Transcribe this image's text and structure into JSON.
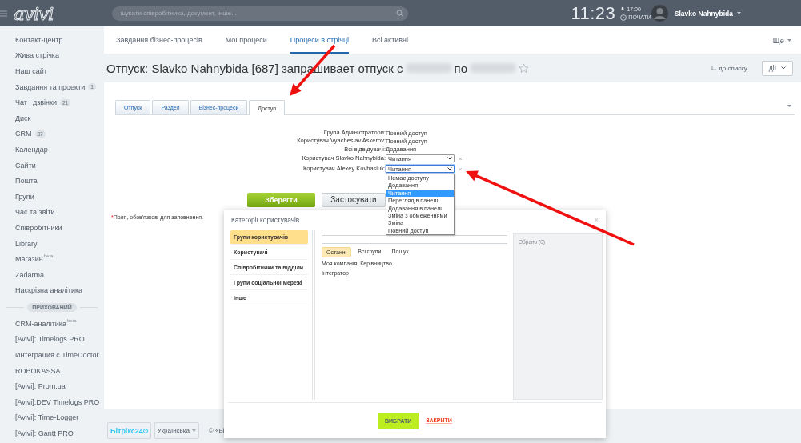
{
  "header": {
    "logo": "avivi",
    "search": {
      "placeholder": "шукати співробітника, документ, інше..."
    },
    "clock": "11:23",
    "alarm": "17:00",
    "start": "ПОЧАТИ",
    "user": "Slavko Nahnybida"
  },
  "sidebar": {
    "items": [
      {
        "label": "Контакт-центр"
      },
      {
        "label": "Жива стрічка"
      },
      {
        "label": "Наш сайт"
      },
      {
        "label": "Завдання та проекти",
        "counter": "1"
      },
      {
        "label": "Чат і дзвінки",
        "counter": "21"
      },
      {
        "label": "Диск"
      },
      {
        "label": "CRM",
        "counter": "37"
      },
      {
        "label": "Календар"
      },
      {
        "label": "Сайти"
      },
      {
        "label": "Пошта"
      },
      {
        "label": "Групи"
      },
      {
        "label": "Час та звіти"
      },
      {
        "label": "Співробітники"
      },
      {
        "label": "Library"
      },
      {
        "label": "Магазин",
        "sup": "beta"
      },
      {
        "label": "Zadarma"
      },
      {
        "label": "Наскрізна аналітика"
      }
    ],
    "hidden_label": "ПРИХОВАНИЙ",
    "hidden_items": [
      {
        "label": "CRM-аналітика",
        "sup": "beta"
      },
      {
        "label": "[Avivi]: Timelogs PRO"
      },
      {
        "label": "Интеграция с TimeDoctor"
      },
      {
        "label": "ROBOKASSA"
      },
      {
        "label": "[Avivi]: Prom.ua"
      },
      {
        "label": "[Avivi]:DEV Timelogs PRO"
      },
      {
        "label": "[Avivi]: Time-Logger"
      },
      {
        "label": "[Avivi]: Gantt PRO"
      }
    ]
  },
  "top_tabs": [
    {
      "label": "Завдання бізнес-процесів",
      "selected": false
    },
    {
      "label": "Мої процеси",
      "selected": false
    },
    {
      "label": "Процеси в стрічці",
      "selected": true
    },
    {
      "label": "Всі активні",
      "selected": false
    }
  ],
  "more": "Ще",
  "title": {
    "text": "Отпуск: Slavko Nahnybida [687] запрашивает отпуск с",
    "between": "по"
  },
  "back_link": "до списку",
  "actions": "дії",
  "form_tabs": [
    {
      "label": "Отпуск",
      "selected": false
    },
    {
      "label": "Раздел",
      "selected": false
    },
    {
      "label": "Бізнес-процеси",
      "selected": false
    },
    {
      "label": "Доступ",
      "selected": true
    }
  ],
  "permissions": [
    {
      "kind": "text",
      "label": "Група Адміністратори:",
      "value": "Повний доступ"
    },
    {
      "kind": "text",
      "label": "Користувач Vyacheslav Askerov:",
      "value": "Повний доступ"
    },
    {
      "kind": "text",
      "label": "Всі відвідувачі:",
      "value": "Додавання"
    },
    {
      "kind": "select",
      "label": "Користувач Slavko Nahnybida:",
      "value": "Читання",
      "expanded": false,
      "remove": "×"
    },
    {
      "kind": "select",
      "label": "Користувач Alexey Kovbasiuk:",
      "value": "Читання",
      "expanded": true,
      "remove": "×"
    }
  ],
  "dropdown_options": [
    {
      "label": "Немає доступу",
      "selected": false
    },
    {
      "label": "Додавання",
      "selected": false
    },
    {
      "label": "Читання",
      "selected": true
    },
    {
      "label": "Перегляд в панелі",
      "selected": false
    },
    {
      "label": "Додавання в панелі",
      "selected": false
    },
    {
      "label": "Зміна з обмеженнями",
      "selected": false
    },
    {
      "label": "Зміна",
      "selected": false
    },
    {
      "label": "Повний доступ",
      "selected": false
    }
  ],
  "buttons": {
    "save": "Зберегти",
    "apply": "Застосувати"
  },
  "required_note": {
    "mark": "*",
    "text": "Поля, обов'язкові для заповнення."
  },
  "dialog": {
    "title": "Категорії користувачів",
    "close": "×",
    "categories": [
      {
        "label": "Групи користувачів",
        "selected": true
      },
      {
        "label": "Користувачі",
        "selected": false
      },
      {
        "label": "Співробітники та відділи",
        "selected": false
      },
      {
        "label": "Групи соціальної мережі",
        "selected": false
      },
      {
        "label": "Інше",
        "selected": false
      }
    ],
    "subtabs": [
      {
        "label": "Останні",
        "selected": true
      },
      {
        "label": "Всі групи",
        "selected": false
      },
      {
        "label": "Пошук",
        "selected": false
      }
    ],
    "items": [
      "Моя компанія: Керівництво",
      "Інтегратор"
    ],
    "chosen": "Обрано (0)",
    "select_button": "ВИБРАТИ",
    "close_button": "ЗАКРИТИ"
  },
  "footer": {
    "brand": "Бітрікс24",
    "language": "Українська",
    "copyright": "© «Бі"
  },
  "annotations": [
    {
      "kind": "arrow"
    },
    {
      "kind": "arrow"
    }
  ]
}
